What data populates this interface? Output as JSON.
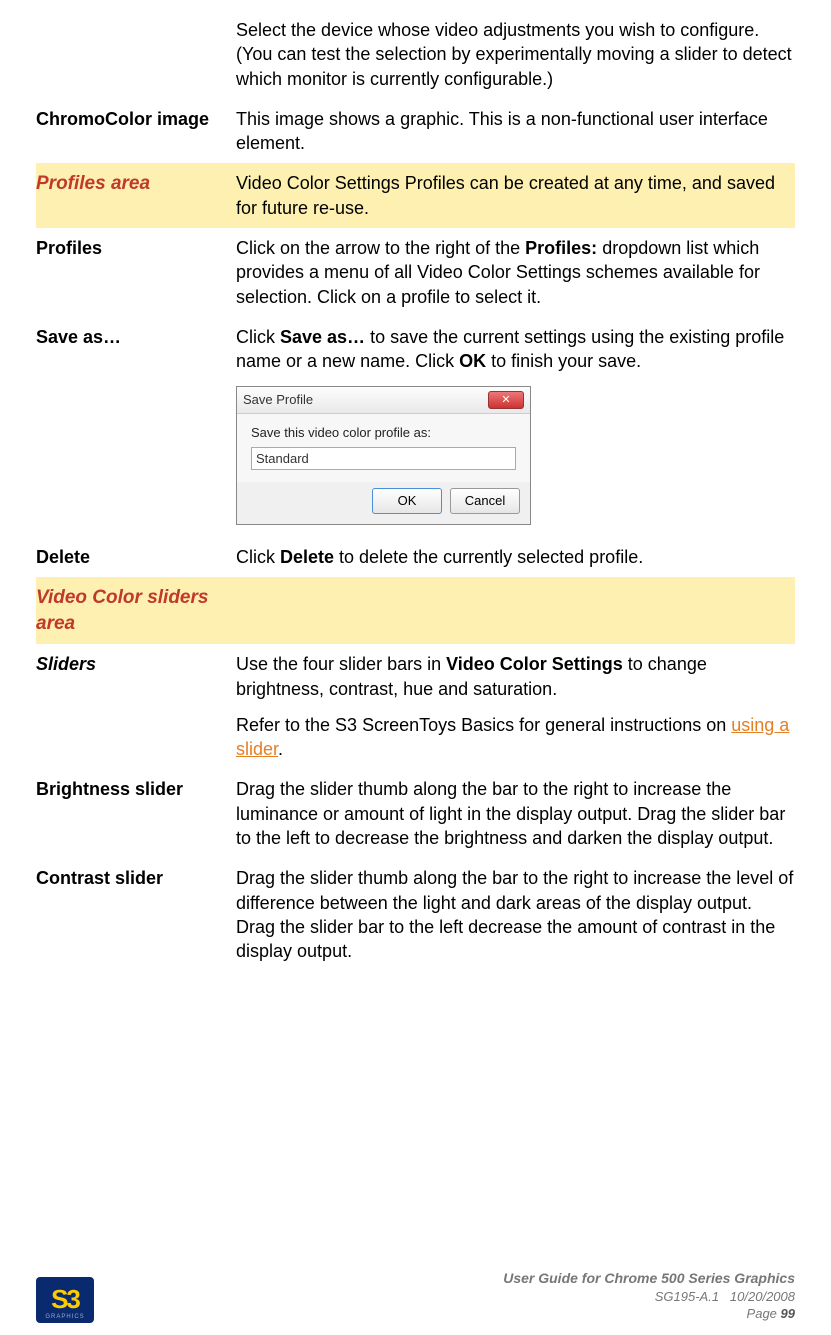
{
  "rows": {
    "intro_desc": "Select the device whose video adjustments you wish to configure. (You can test the selection by experimentally moving a slider to detect which monitor is currently configurable.)",
    "chromo_label": "ChromoColor image",
    "chromo_desc": "This image shows a graphic. This is a non-functional user interface element.",
    "profiles_area_label": "Profiles area",
    "profiles_area_desc": "Video Color Settings Profiles can be created at any time, and saved for future re-use.",
    "profiles_label": "Profiles",
    "profiles_desc_pre": "Click on the arrow to the right of the ",
    "profiles_desc_bold": "Profiles:",
    "profiles_desc_post": " dropdown list which provides a menu of all Video Color Settings schemes available for selection. Click on a profile to select it.",
    "saveas_label": "Save as…",
    "saveas_desc_pre": "Click ",
    "saveas_desc_b1": "Save as…",
    "saveas_desc_mid": " to save the current settings using the existing profile name or a new name. Click ",
    "saveas_desc_b2": "OK",
    "saveas_desc_post": " to finish your save.",
    "delete_label": "Delete",
    "delete_desc_pre": "Click ",
    "delete_desc_b": "Delete",
    "delete_desc_post": " to delete the currently selected profile.",
    "sliders_area_label": "Video Color sliders area",
    "sliders_label": "Sliders",
    "sliders_p1_pre": "Use the four slider bars in ",
    "sliders_p1_b": "Video Color Settings",
    "sliders_p1_post": " to change brightness, contrast, hue and saturation.",
    "sliders_p2_pre": "Refer to the S3 ScreenToys Basics for general instructions on ",
    "sliders_p2_link": "using a slider",
    "sliders_p2_post": ".",
    "brightness_label": "Brightness slider",
    "brightness_desc": "Drag the slider thumb along the bar to the right to increase the luminance or amount of light in the display output. Drag the slider bar to the left to decrease the brightness and darken the display output.",
    "contrast_label": "Contrast slider",
    "contrast_desc": "Drag the slider thumb along the bar to the right to increase the level of difference between the light and dark areas of the display output. Drag the slider bar to the left decrease the amount of contrast in the display output."
  },
  "dialog": {
    "title": "Save Profile",
    "prompt": "Save this video color profile as:",
    "value": "Standard",
    "ok": "OK",
    "cancel": "Cancel",
    "close": "✕"
  },
  "footer": {
    "logo_text": "S3",
    "logo_sub": "GRAPHICS",
    "title": "User Guide for Chrome 500 Series Graphics",
    "docid": "SG195-A.1",
    "date": "10/20/2008",
    "page_label": "Page ",
    "page_num": "99"
  }
}
